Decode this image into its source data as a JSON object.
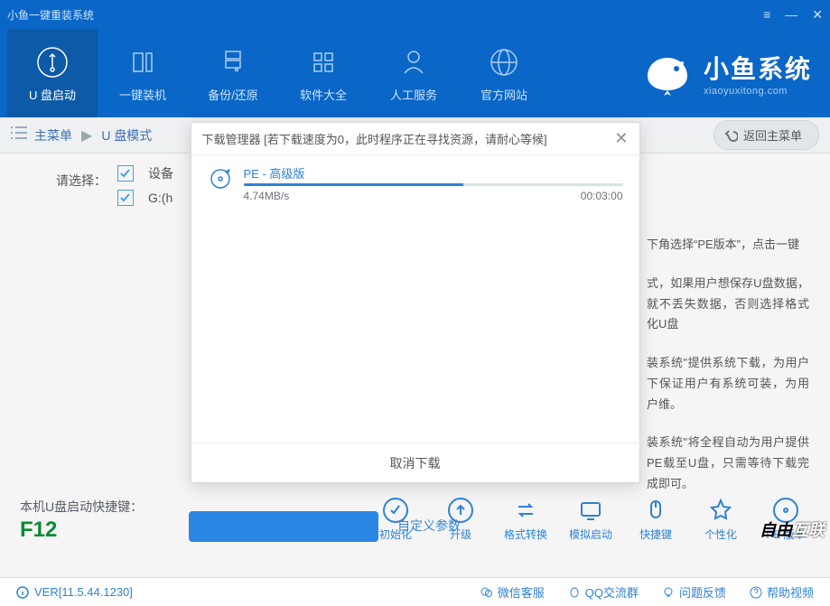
{
  "titlebar": {
    "title": "小鱼一键重装系统"
  },
  "nav": {
    "items": [
      {
        "label": "U 盘启动"
      },
      {
        "label": "一键装机"
      },
      {
        "label": "备份/还原"
      },
      {
        "label": "软件大全"
      },
      {
        "label": "人工服务"
      },
      {
        "label": "官方网站"
      }
    ]
  },
  "brand": {
    "cn": "小鱼系统",
    "en": "xiaoyuxitong.com"
  },
  "breadcrumb": {
    "root": "主菜单",
    "current": "U 盘模式",
    "back": "返回主菜单"
  },
  "body": {
    "prompt": "请选择：",
    "check_labels": [
      "设备",
      "G:(h"
    ],
    "hidden_text_1": "下角选择“PE版本”，点击一键",
    "hidden_text_2": "式，如果用户想保存U盘数据，就不丢失数据，否则选择格式化U盘",
    "hidden_text_3": "装系统\"提供系统下载，为用户下保证用户有系统可装，为用户维。",
    "hidden_text_4": "装系统\"将全程自动为用户提供PE载至U盘，只需等待下载完成即可。",
    "link_stub": "自定义参数"
  },
  "dialog": {
    "title": "下载管理器 [若下载速度为0，此时程序正在寻找资源，请耐心等候]",
    "item_name": "PE - 高级版",
    "speed": "4.74MB/s",
    "time": "00:03:00",
    "cancel": "取消下载"
  },
  "shortcut": {
    "label": "本机U盘启动快捷键：",
    "key": "F12"
  },
  "actions": [
    {
      "label": "初始化"
    },
    {
      "label": "升级"
    },
    {
      "label": "格式转换"
    },
    {
      "label": "模拟启动"
    },
    {
      "label": "快捷键"
    },
    {
      "label": "个性化"
    },
    {
      "label": "PE 版本"
    }
  ],
  "watermark": {
    "left": "自由",
    "right": "互联"
  },
  "statusbar": {
    "version": "VER[11.5.44.1230]",
    "links": [
      "微信客服",
      "QQ交流群",
      "问题反馈",
      "帮助视频"
    ]
  }
}
